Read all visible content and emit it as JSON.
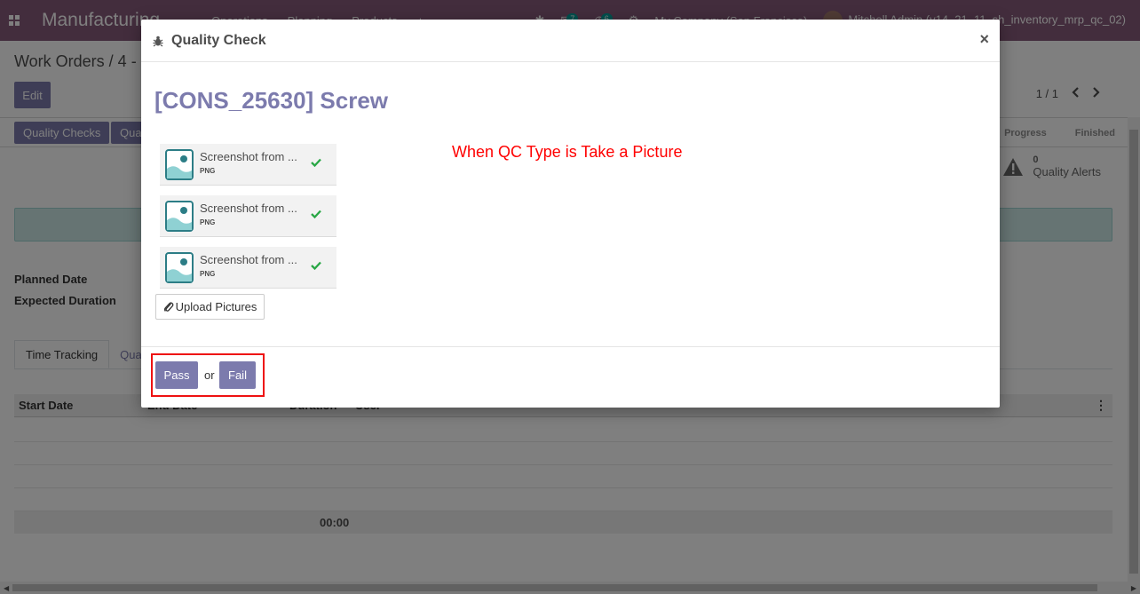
{
  "app": {
    "brand": "Manufacturing",
    "menu": [
      "Operations",
      "Planning",
      "Products"
    ],
    "plus_label": "+",
    "messages_count": "7",
    "activities_count": "6",
    "company": "My Company (San Francisco)",
    "user": "Mitchell Admin (v14_21_11_sh_inventory_mrp_qc_02)"
  },
  "control_panel": {
    "breadcrumb": "Work Orders / 4 -",
    "edit_label": "Edit",
    "pager": "1 / 1"
  },
  "statusbar": {
    "quality_checks_label": "Quality Checks",
    "second_button_label": "Qua",
    "stages": [
      "Progress",
      "Finished"
    ]
  },
  "smart_button": {
    "count": "0",
    "label": "Quality Alerts"
  },
  "form": {
    "planned_date_label": "Planned Date",
    "expected_duration_label": "Expected Duration",
    "tabs": [
      "Time Tracking",
      "Qua"
    ],
    "table_headers": [
      "Start Date",
      "End Date",
      "Duration",
      "User"
    ],
    "total_duration": "00:00"
  },
  "modal": {
    "title": "Quality Check",
    "close_symbol": "×",
    "product": "[CONS_25630] Screw",
    "note": "When QC Type is Take a Picture",
    "attachments": [
      {
        "name": "Screenshot from ...",
        "ext": "PNG"
      },
      {
        "name": "Screenshot from ...",
        "ext": "PNG"
      },
      {
        "name": "Screenshot from ...",
        "ext": "PNG"
      }
    ],
    "upload_label": "Upload Pictures",
    "pass_label": "Pass",
    "or_label": "or",
    "fail_label": "Fail"
  },
  "colors": {
    "brand": "#875a7b",
    "primary": "#7c7bad",
    "check": "#28a745",
    "note": "#ff0000"
  }
}
